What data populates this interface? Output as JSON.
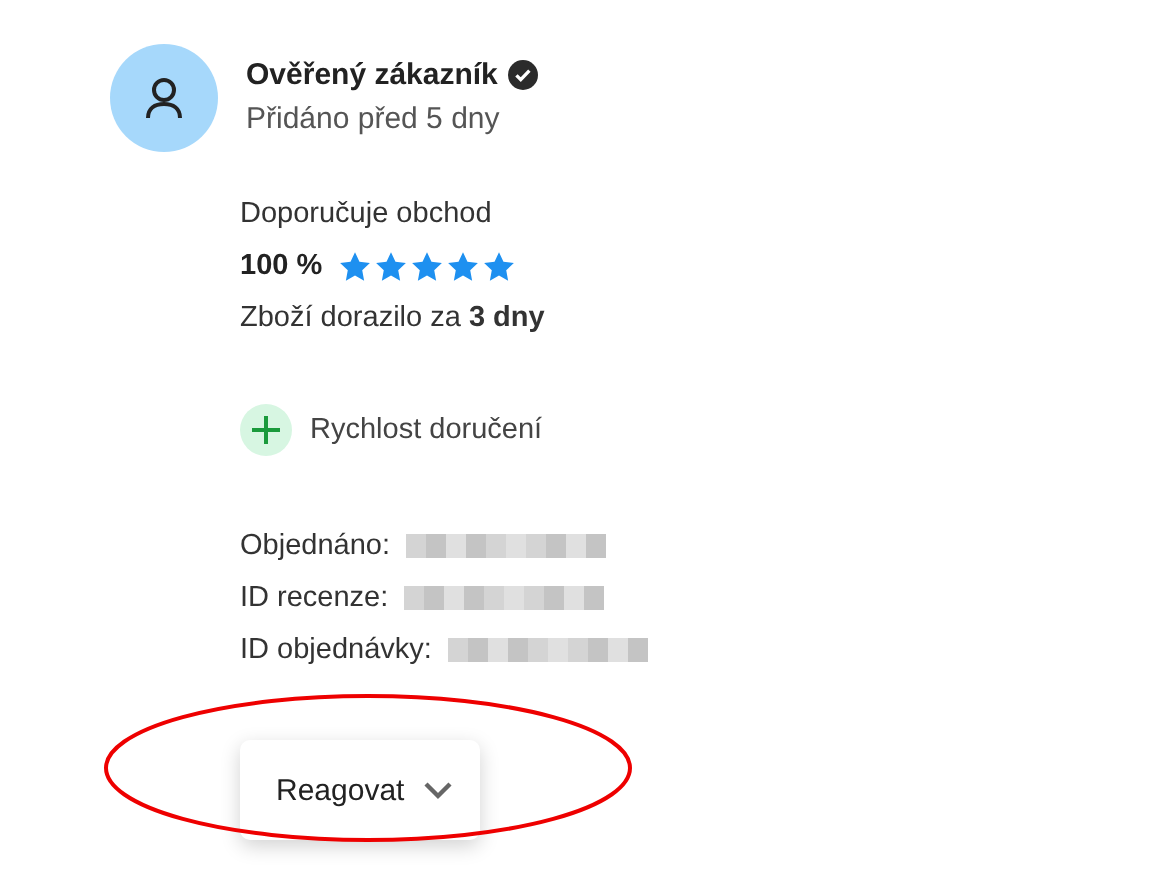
{
  "review": {
    "author": "Ověřený zákazník",
    "verified": true,
    "added": "Přidáno před 5 dny",
    "recommend_label": "Doporučuje obchod",
    "percent": "100 %",
    "stars": 5,
    "delivery_prefix": "Zboží dorazilo za",
    "delivery_time": "3 dny",
    "pros": [
      {
        "text": "Rychlost doručení"
      }
    ],
    "details": [
      {
        "label": "Objednáno:"
      },
      {
        "label": "ID recenze:"
      },
      {
        "label": "ID objednávky:"
      }
    ],
    "react_button": "Reagovat"
  }
}
